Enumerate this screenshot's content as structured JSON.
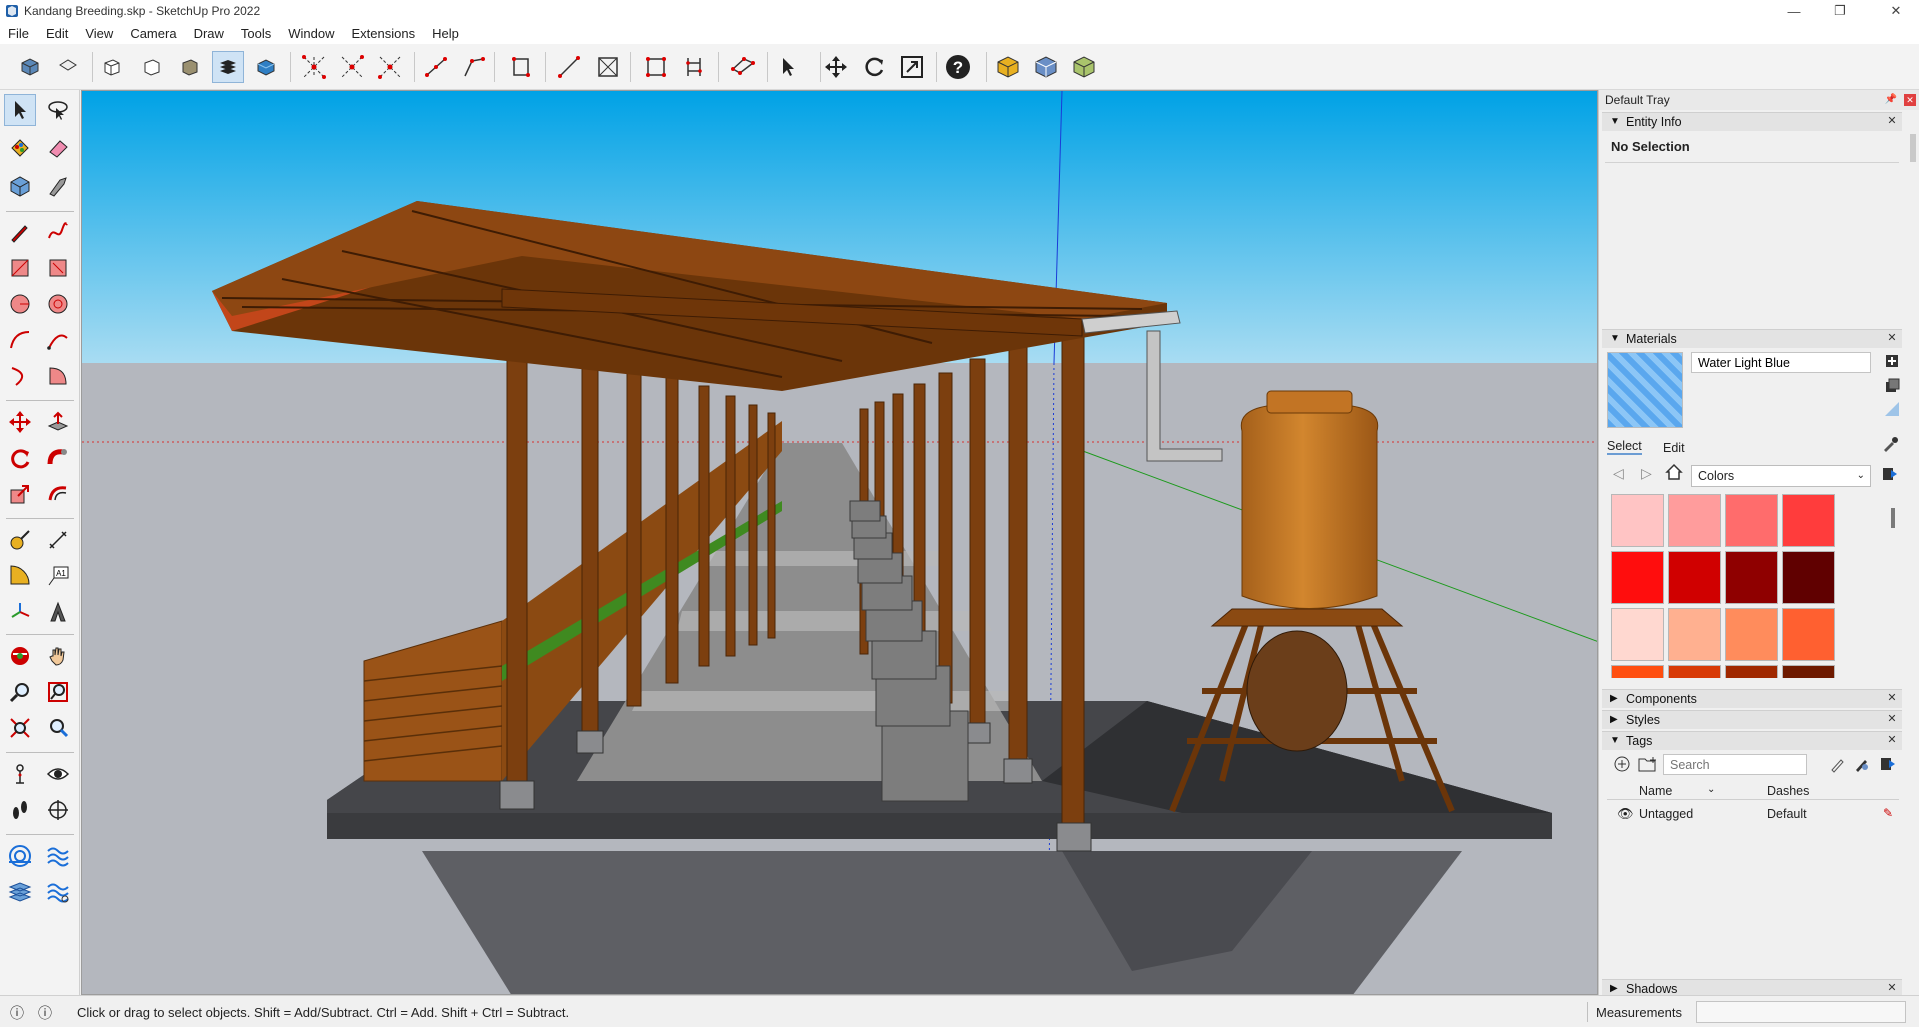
{
  "window": {
    "title": "Kandang Breeding.skp - SketchUp Pro 2022",
    "minimize_label": "—",
    "restore_label": "❐",
    "close_label": "✕"
  },
  "menu": [
    "File",
    "Edit",
    "View",
    "Camera",
    "Draw",
    "Tools",
    "Window",
    "Extensions",
    "Help"
  ],
  "toolbar_icons": [
    "iso-view-icon",
    "top-view-icon",
    "front-view-icon",
    "right-view-icon",
    "back-view-icon",
    "layers-stack-icon",
    "shaded-textures-icon",
    "axes-move-icon",
    "axes-rotate-icon",
    "axes-scale-icon",
    "line-icon",
    "arc-icon",
    "section-icon",
    "tape-icon",
    "box-select-icon",
    "frame-icon",
    "dimension-icon",
    "polyline-icon",
    "select-arrow-icon",
    "move-icon",
    "orbit-icon",
    "zoom-extents-icon",
    "help-icon",
    "3d-warehouse-icon",
    "extension-warehouse-icon",
    "layout-icon"
  ],
  "tray": {
    "title": "Default Tray",
    "entity_info": {
      "label": "Entity Info",
      "selection": "No Selection"
    },
    "materials": {
      "label": "Materials",
      "current_material": "Water Light Blue",
      "tab_select": "Select",
      "tab_edit": "Edit",
      "library": "Colors",
      "swatches": [
        "#ffc4c4",
        "#ff9c9c",
        "#ff6c6c",
        "#ff3c3c",
        "#ff0d0d",
        "#d00000",
        "#8f0000",
        "#600000",
        "#ffd8d0",
        "#ffb090",
        "#ff8c5c",
        "#ff6030",
        "#ff4f10",
        "#d83a06",
        "#a02800",
        "#6e1a00"
      ]
    },
    "components": {
      "label": "Components"
    },
    "styles": {
      "label": "Styles"
    },
    "tags": {
      "label": "Tags",
      "search_placeholder": "Search",
      "col_name": "Name",
      "col_dashes": "Dashes",
      "rows": [
        {
          "name": "Untagged",
          "dashes": "Default"
        }
      ]
    },
    "shadows": {
      "label": "Shadows"
    }
  },
  "status": {
    "hint": "Click or drag to select objects. Shift = Add/Subtract. Ctrl = Add. Shift + Ctrl = Subtract.",
    "measurements_label": "Measurements",
    "measurements_value": ""
  },
  "colors": {
    "sky_top": "#00a2e6",
    "sky_bottom": "#a8dcf2",
    "ground": "#b4b7be",
    "wood": "#8b4a12",
    "tank": "#c87a24"
  }
}
